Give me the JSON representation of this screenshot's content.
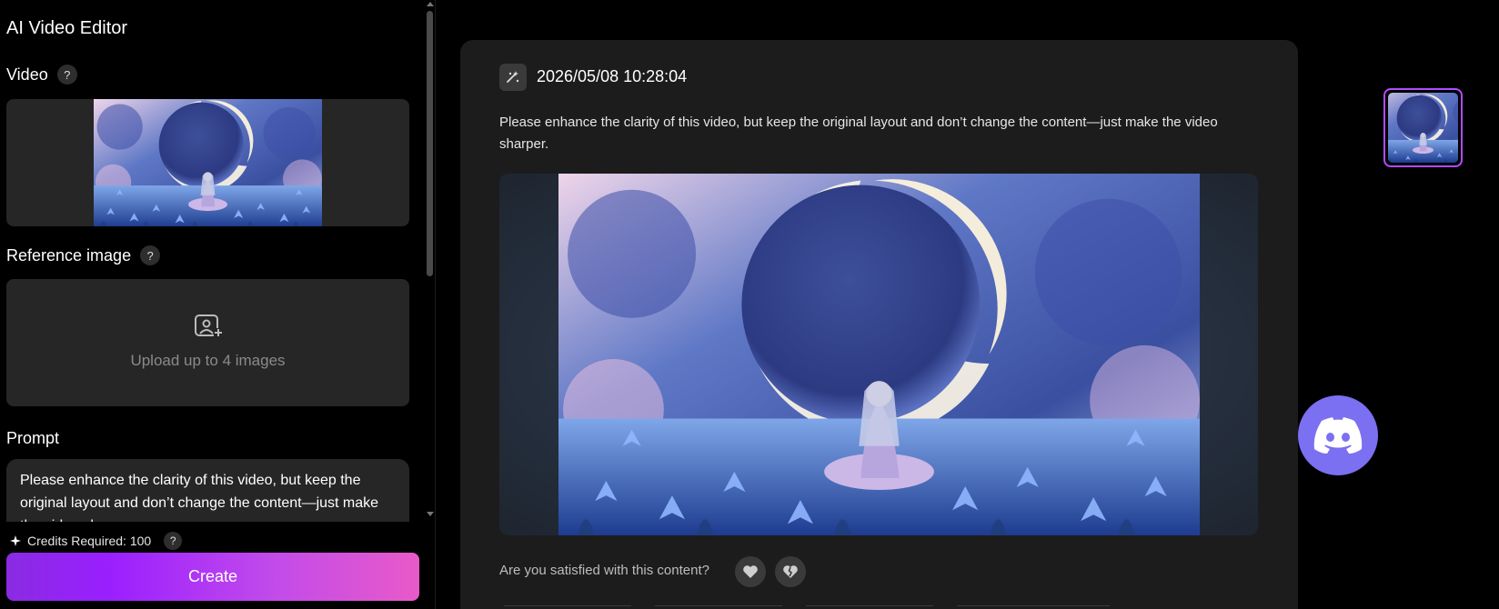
{
  "app": {
    "title": "AI Video Editor"
  },
  "sections": {
    "video": {
      "label": "Video",
      "help": "?"
    },
    "reference": {
      "label": "Reference image",
      "help": "?",
      "upload_text": "Upload up to 4 images"
    },
    "prompt": {
      "label": "Prompt",
      "value": "Please enhance the clarity of this video, but keep the original layout and don’t change the content—just make the video sharper."
    }
  },
  "footer": {
    "credits_label": "Credits Required: 100",
    "credits_help": "?",
    "create_label": "Create"
  },
  "task": {
    "timestamp": "2026/05/08 10:28:04",
    "prompt": "Please enhance the clarity of this video, but keep the original layout and don’t change the content—just make the video sharper.",
    "feedback_question": "Are you satisfied with this content?"
  },
  "icons": {
    "task": "task-sparkle-icon",
    "upload": "image-upload-icon",
    "credits": "sparkle-icon",
    "like": "heart-icon",
    "dislike": "broken-heart-icon",
    "discord": "discord-icon"
  },
  "colors": {
    "accent_gradient_start": "#8a2be2",
    "accent_gradient_end": "#e85ac8",
    "selected_border": "#b04cff",
    "discord": "#7b6ff2",
    "panel": "#262626",
    "card": "#1c1c1c"
  }
}
